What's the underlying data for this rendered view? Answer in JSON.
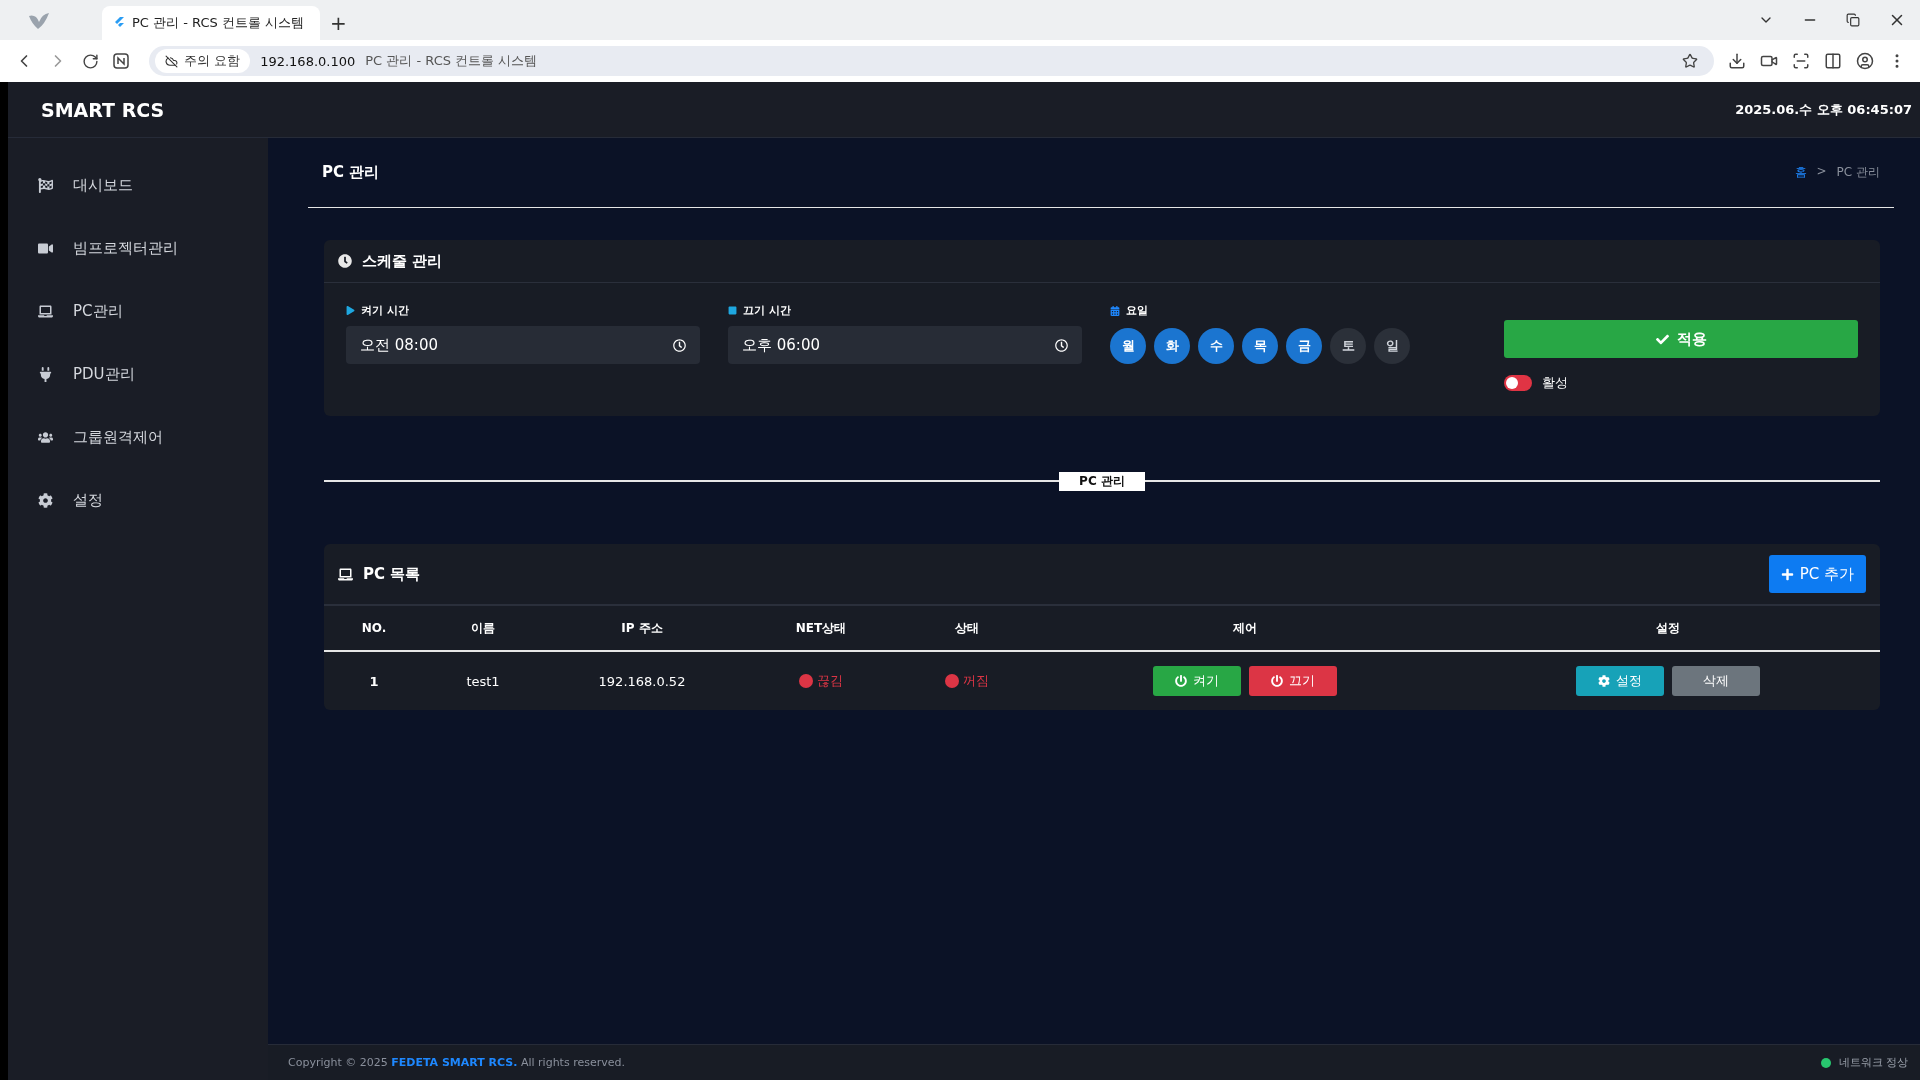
{
  "browser": {
    "tab_title": "PC 관리 - RCS 컨트롤 시스템",
    "new_tab": "+",
    "security_chip": "주의 요함",
    "url": "192.168.0.100",
    "url_title": "PC 관리 - RCS 컨트롤 시스템"
  },
  "header": {
    "brand": "SMART RCS",
    "datetime": "2025.06.수 오후 06:45:07"
  },
  "sidebar": {
    "items": [
      {
        "label": "대시보드",
        "kind": "flag"
      },
      {
        "label": "빔프로젝터관리",
        "kind": "projector"
      },
      {
        "label": "PC관리",
        "kind": "laptop"
      },
      {
        "label": "PDU관리",
        "kind": "plug"
      },
      {
        "label": "그룹원격제어",
        "kind": "users"
      },
      {
        "label": "설정",
        "kind": "gear"
      }
    ]
  },
  "page": {
    "title": "PC 관리",
    "breadcrumb": {
      "home": "홈",
      "separator": ">",
      "current": "PC 관리"
    }
  },
  "schedule": {
    "title": "스케줄 관리",
    "on_time": {
      "label": "켜기 시간",
      "value": "오전 08:00"
    },
    "off_time": {
      "label": "끄기 시간",
      "value": "오후 06:00"
    },
    "days_label": "요일",
    "days": [
      {
        "label": "월",
        "selected": true
      },
      {
        "label": "화",
        "selected": true
      },
      {
        "label": "수",
        "selected": true
      },
      {
        "label": "목",
        "selected": true
      },
      {
        "label": "금",
        "selected": true
      },
      {
        "label": "토",
        "selected": false
      },
      {
        "label": "일",
        "selected": false
      }
    ],
    "apply_button": "적용",
    "active": {
      "label": "활성",
      "on": false
    }
  },
  "section_divider": "PC 관리",
  "pc_list": {
    "title": "PC 목록",
    "add_button": "PC 추가",
    "columns": [
      "NO.",
      "이름",
      "IP 주소",
      "NET상태",
      "상태",
      "제어",
      "설정"
    ],
    "rows": [
      {
        "no": "1",
        "name": "test1",
        "ip": "192.168.0.52",
        "net": {
          "text": "끊김",
          "color": "#dc3545"
        },
        "status": {
          "text": "꺼짐",
          "color": "#dc3545"
        },
        "on_button": "켜기",
        "off_button": "끄기",
        "settings_button": "설정",
        "delete_button": "삭제"
      }
    ]
  },
  "footer": {
    "copyright": "Copyright © 2025 **FEDETA SMART RCS.** All rights reserved.",
    "network": {
      "text": "네트워크 정상",
      "color": "#28c76f"
    }
  }
}
